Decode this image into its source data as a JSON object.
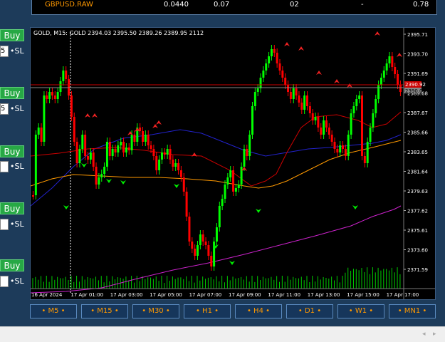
{
  "top_row": {
    "symbol": "GBPUSD.RAW",
    "v1": "0.0440",
    "v2": "0.07",
    "v3": "02",
    "v4": "-",
    "v5": "0.78"
  },
  "buy_panel": {
    "buy_label": "Buy",
    "sl_label": "•SL",
    "rows": [
      {
        "qty": "5"
      },
      {
        "qty": "5"
      },
      {
        "qty": ""
      },
      {
        "qty": ""
      },
      {
        "qty": ""
      }
    ]
  },
  "chart": {
    "header": "GOLD, M15:  GOLD  2394.03 2395.50 2389.26 2389.95  2112",
    "current_price_top": "2390.92",
    "current_price_bottom": "2390.02",
    "price_labels": [
      "2395.71",
      "2393.70",
      "2391.69",
      "2389.68",
      "2387.67",
      "2385.66",
      "2383.65",
      "2381.64",
      "2379.63",
      "2377.62",
      "2375.61",
      "2373.60",
      "2371.59"
    ],
    "time_labels": [
      "16 Apr 2024",
      "17 Apr 01:00",
      "17 Apr 03:00",
      "17 Apr 05:00",
      "17 Apr 07:00",
      "17 Apr 09:00",
      "17 Apr 11:00",
      "17 Apr 13:00",
      "17 Apr 15:00",
      "17 Apr 17:00"
    ],
    "colors": {
      "bull": "#00ff00",
      "bear": "#ff0000",
      "ma_red": "#cc0000",
      "ma_blue": "#2222cc",
      "ma_orange": "#ff9900",
      "ma_magenta": "#cc22cc",
      "volume": "#00cc00",
      "signal_up": "#00ee00",
      "signal_down": "#ee2222"
    }
  },
  "timeframes": [
    "• M5 •",
    "• M15 •",
    "• M30 •",
    "• H1 •",
    "• H4 •",
    "• D1 •",
    "• W1 •",
    "• MN1 •"
  ],
  "status": {
    "left_arrow": "◂",
    "right_arrow": "▸"
  }
}
